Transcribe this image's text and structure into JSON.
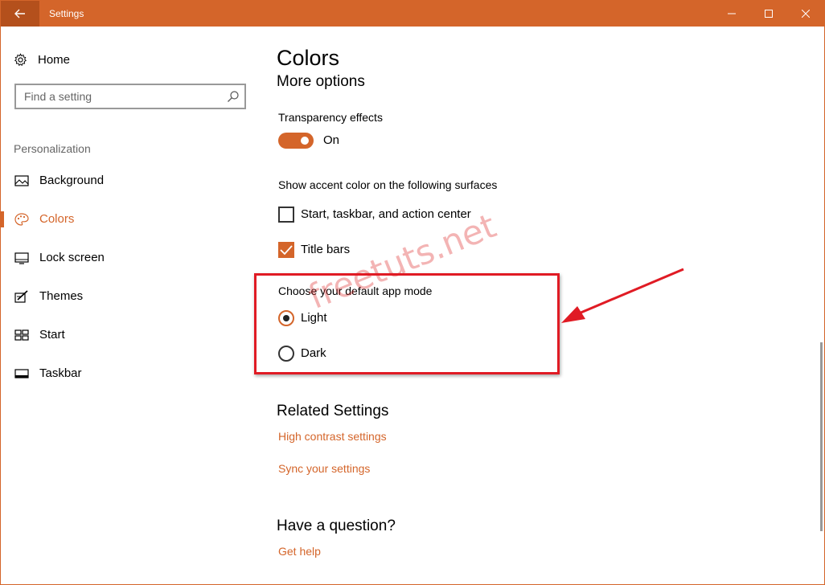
{
  "window": {
    "title": "Settings",
    "accent_color": "#d4652a"
  },
  "titlebar": {
    "back_icon": "back-arrow-icon",
    "controls": [
      "minimize-icon",
      "maximize-icon",
      "close-icon"
    ]
  },
  "sidebar": {
    "home_label": "Home",
    "search_placeholder": "Find a setting",
    "section_header": "Personalization",
    "items": [
      {
        "label": "Background",
        "icon": "picture-icon"
      },
      {
        "label": "Colors",
        "icon": "palette-icon",
        "active": true
      },
      {
        "label": "Lock screen",
        "icon": "lock-screen-icon"
      },
      {
        "label": "Themes",
        "icon": "themes-icon"
      },
      {
        "label": "Start",
        "icon": "start-icon"
      },
      {
        "label": "Taskbar",
        "icon": "taskbar-icon"
      }
    ]
  },
  "main": {
    "page_title": "Colors",
    "sub_title": "More options",
    "transparency": {
      "label": "Transparency effects",
      "state": "On"
    },
    "accent_surfaces": {
      "label": "Show accent color on the following surfaces",
      "options": [
        {
          "label": "Start, taskbar, and action center",
          "checked": false
        },
        {
          "label": "Title bars",
          "checked": true
        }
      ]
    },
    "app_mode": {
      "label": "Choose your default app mode",
      "options": [
        {
          "label": "Light",
          "selected": true
        },
        {
          "label": "Dark",
          "selected": false
        }
      ]
    },
    "related": {
      "title": "Related Settings",
      "links": [
        "High contrast settings",
        "Sync your settings"
      ]
    },
    "question": {
      "title": "Have a question?",
      "link": "Get help"
    }
  },
  "annotation": {
    "watermark": "freetuts.net",
    "highlight_color": "#e01b24"
  }
}
